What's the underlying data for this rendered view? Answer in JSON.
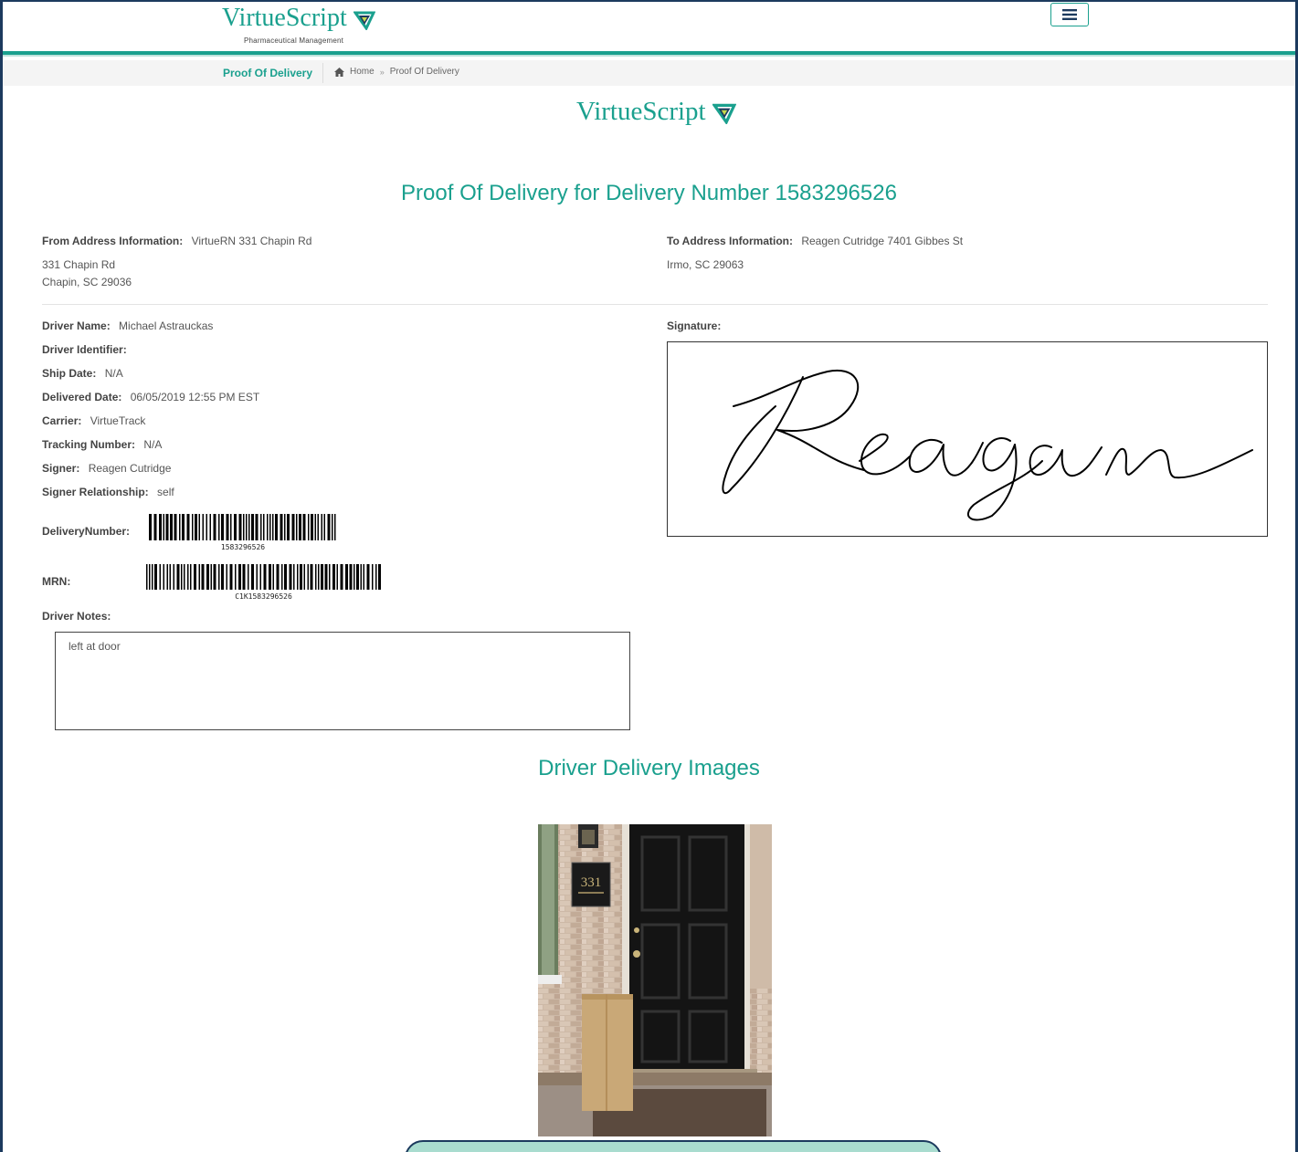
{
  "header": {
    "logo_text": "VirtueScript",
    "logo_tagline": "Pharmaceutical Management",
    "menu_icon": "hamburger-icon"
  },
  "breadcrumb": {
    "page_title": "Proof Of Delivery",
    "home_label": "Home",
    "current_label": "Proof Of Delivery"
  },
  "document": {
    "logo_text": "VirtueScript",
    "title": "Proof Of Delivery for Delivery Number 1583296526",
    "from": {
      "label": "From Address Information:",
      "value": "VirtueRN 331 Chapin Rd",
      "line1": "331 Chapin Rd",
      "line2": "Chapin, SC 29036"
    },
    "to": {
      "label": "To Address Information:",
      "value": "Reagen Cutridge 7401 Gibbes St",
      "line1": "Irmo, SC 29063"
    },
    "fields": {
      "driver_name": {
        "label": "Driver Name:",
        "value": "Michael Astrauckas"
      },
      "driver_identifier": {
        "label": "Driver Identifier:",
        "value": ""
      },
      "ship_date": {
        "label": "Ship Date:",
        "value": "N/A"
      },
      "delivered_date": {
        "label": "Delivered Date:",
        "value": "06/05/2019 12:55 PM EST"
      },
      "carrier": {
        "label": "Carrier:",
        "value": "VirtueTrack"
      },
      "tracking_number": {
        "label": "Tracking Number:",
        "value": "N/A"
      },
      "signer": {
        "label": "Signer:",
        "value": "Reagen Cutridge"
      },
      "signer_relationship": {
        "label": "Signer Relationship:",
        "value": "self"
      }
    },
    "delivery_number": {
      "label": "DeliveryNumber:",
      "barcode_text": "1583296526"
    },
    "mrn": {
      "label": "MRN:",
      "barcode_text": "C1K1583296526"
    },
    "signature_label": "Signature:",
    "signature_name": "Reagan",
    "driver_notes": {
      "label": "Driver Notes:",
      "value": "left at door"
    },
    "images_title": "Driver Delivery Images",
    "house_number": "331"
  },
  "colors": {
    "accent": "#1aa08e",
    "navy": "#1c3a5e"
  }
}
